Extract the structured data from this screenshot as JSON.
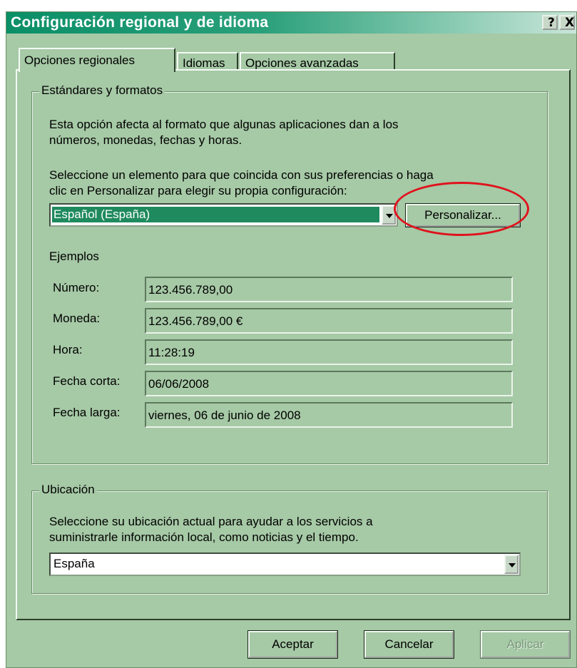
{
  "window": {
    "title": "Configuración regional y de idioma",
    "help_label": "?",
    "close_label": "X"
  },
  "tabs": [
    {
      "label": "Opciones regionales",
      "active": true
    },
    {
      "label": "Idiomas",
      "active": false
    },
    {
      "label": "Opciones avanzadas",
      "active": false
    }
  ],
  "standards": {
    "legend": "Estándares y formatos",
    "description_line1": "Esta opción afecta al formato que algunas aplicaciones dan a los",
    "description_line2": "números, monedas, fechas y horas.",
    "instruction_line1": "Seleccione un elemento para que coincida con sus preferencias o haga",
    "instruction_line2": "clic en Personalizar para elegir su propia configuración:",
    "selected_locale": "Español (España)",
    "customize_label": "Personalizar..."
  },
  "examples": {
    "heading": "Ejemplos",
    "rows": [
      {
        "label": "Número:",
        "value": "123.456.789,00"
      },
      {
        "label": "Moneda:",
        "value": "123.456.789,00 €"
      },
      {
        "label": "Hora:",
        "value": "11:28:19"
      },
      {
        "label": "Fecha corta:",
        "value": "06/06/2008"
      },
      {
        "label": "Fecha larga:",
        "value": "viernes, 06 de junio de 2008"
      }
    ]
  },
  "location": {
    "legend": "Ubicación",
    "description_line1": "Seleccione su ubicación actual para ayudar a los servicios a",
    "description_line2": "suministrarle información local, como noticias y el tiempo.",
    "selected_location": "España"
  },
  "footer": {
    "ok_label": "Aceptar",
    "cancel_label": "Cancelar",
    "apply_label": "Aplicar"
  },
  "colors": {
    "annotation": "#e0121d",
    "title_gradient_start": "#0a8f66",
    "dialog_face": "#a6c9a6",
    "selection": "#1f8a5e"
  },
  "icons": {
    "dropdown": "chevron-down-icon"
  }
}
